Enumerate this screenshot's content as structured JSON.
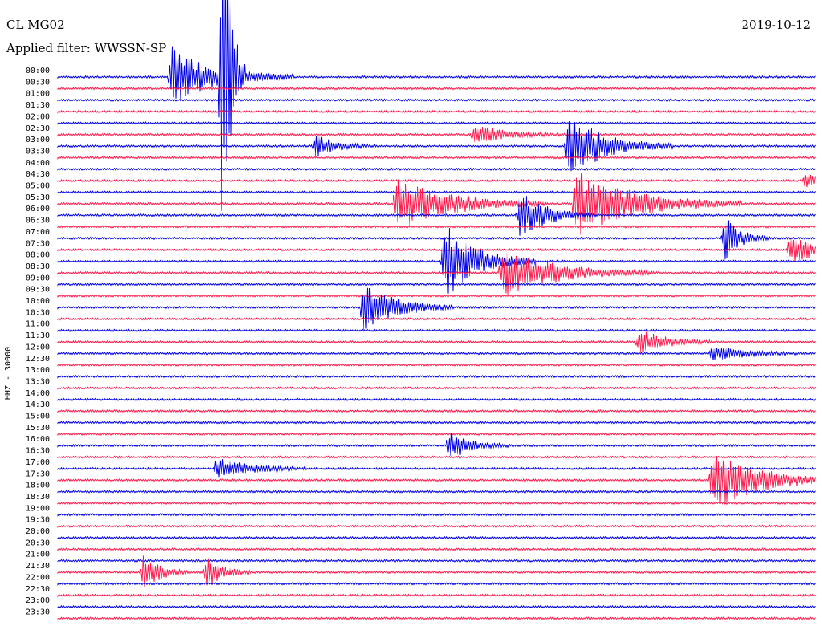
{
  "header": {
    "station": "CL MG02",
    "date": "2019-10-12",
    "filter": "Applied filter: WWSSN-SP"
  },
  "chart_data": {
    "type": "helicorder",
    "ylabel": "HHZ - 30000",
    "colors": [
      "#0000e6",
      "#ff1a4d"
    ],
    "traces": [
      {
        "label": "00:00",
        "color": "blue"
      },
      {
        "label": "00:30",
        "color": "red"
      },
      {
        "label": "01:00",
        "color": "blue"
      },
      {
        "label": "01:30",
        "color": "red"
      },
      {
        "label": "02:00",
        "color": "blue"
      },
      {
        "label": "02:30",
        "color": "red"
      },
      {
        "label": "03:00",
        "color": "blue"
      },
      {
        "label": "03:30",
        "color": "red"
      },
      {
        "label": "04:00",
        "color": "blue"
      },
      {
        "label": "04:30",
        "color": "red"
      },
      {
        "label": "05:00",
        "color": "blue"
      },
      {
        "label": "05:30",
        "color": "red"
      },
      {
        "label": "06:00",
        "color": "blue"
      },
      {
        "label": "06:30",
        "color": "red"
      },
      {
        "label": "07:00",
        "color": "blue"
      },
      {
        "label": "07:30",
        "color": "red"
      },
      {
        "label": "08:00",
        "color": "blue"
      },
      {
        "label": "08:30",
        "color": "red"
      },
      {
        "label": "09:00",
        "color": "blue"
      },
      {
        "label": "09:30",
        "color": "red"
      },
      {
        "label": "10:00",
        "color": "blue"
      },
      {
        "label": "10:30",
        "color": "red"
      },
      {
        "label": "11:00",
        "color": "blue"
      },
      {
        "label": "11:30",
        "color": "red"
      },
      {
        "label": "12:00",
        "color": "blue"
      },
      {
        "label": "12:30",
        "color": "red"
      },
      {
        "label": "13:00",
        "color": "blue"
      },
      {
        "label": "13:30",
        "color": "red"
      },
      {
        "label": "14:00",
        "color": "blue"
      },
      {
        "label": "14:30",
        "color": "red"
      },
      {
        "label": "15:00",
        "color": "blue"
      },
      {
        "label": "15:30",
        "color": "red"
      },
      {
        "label": "16:00",
        "color": "blue"
      },
      {
        "label": "16:30",
        "color": "red"
      },
      {
        "label": "17:00",
        "color": "blue"
      },
      {
        "label": "17:30",
        "color": "red"
      },
      {
        "label": "18:00",
        "color": "blue"
      },
      {
        "label": "18:30",
        "color": "red"
      },
      {
        "label": "19:00",
        "color": "blue"
      },
      {
        "label": "19:30",
        "color": "red"
      },
      {
        "label": "20:00",
        "color": "blue"
      },
      {
        "label": "20:30",
        "color": "red"
      },
      {
        "label": "21:00",
        "color": "blue"
      },
      {
        "label": "21:30",
        "color": "red"
      },
      {
        "label": "22:00",
        "color": "blue"
      },
      {
        "label": "22:30",
        "color": "red"
      },
      {
        "label": "23:00",
        "color": "blue"
      },
      {
        "label": "23:30",
        "color": "red"
      }
    ],
    "events": [
      {
        "trace": 0,
        "minute": 4.5,
        "amp": 38,
        "dur": 1.6
      },
      {
        "trace": 0,
        "minute": 6.5,
        "amp": 260,
        "dur": 0.3
      },
      {
        "trace": 5,
        "minute": 16.5,
        "amp": 12,
        "dur": 1.2
      },
      {
        "trace": 6,
        "minute": 10.2,
        "amp": 14,
        "dur": 0.8
      },
      {
        "trace": 6,
        "minute": 20.2,
        "amp": 40,
        "dur": 1.4
      },
      {
        "trace": 9,
        "minute": 29.6,
        "amp": 8,
        "dur": 1.0
      },
      {
        "trace": 11,
        "minute": 13.4,
        "amp": 34,
        "dur": 2.0
      },
      {
        "trace": 11,
        "minute": 20.5,
        "amp": 42,
        "dur": 2.2
      },
      {
        "trace": 12,
        "minute": 18.3,
        "amp": 30,
        "dur": 1.0
      },
      {
        "trace": 14,
        "minute": 26.4,
        "amp": 28,
        "dur": 0.6
      },
      {
        "trace": 14,
        "minute": 43.2,
        "amp": 260,
        "dur": 2.4
      },
      {
        "trace": 15,
        "minute": 29.0,
        "amp": 18,
        "dur": 1.0
      },
      {
        "trace": 16,
        "minute": 15.3,
        "amp": 48,
        "dur": 1.2
      },
      {
        "trace": 17,
        "minute": 17.6,
        "amp": 30,
        "dur": 2.0
      },
      {
        "trace": 17,
        "minute": 51.2,
        "amp": 58,
        "dur": 1.4
      },
      {
        "trace": 20,
        "minute": 12.1,
        "amp": 32,
        "dur": 1.2
      },
      {
        "trace": 20,
        "minute": 53.4,
        "amp": 42,
        "dur": 2.4
      },
      {
        "trace": 23,
        "minute": 23.0,
        "amp": 16,
        "dur": 1.0
      },
      {
        "trace": 24,
        "minute": 25.9,
        "amp": 10,
        "dur": 1.2
      },
      {
        "trace": 29,
        "minute": 39.4,
        "amp": 16,
        "dur": 1.6
      },
      {
        "trace": 32,
        "minute": 15.5,
        "amp": 18,
        "dur": 0.8
      },
      {
        "trace": 34,
        "minute": 6.3,
        "amp": 14,
        "dur": 1.2
      },
      {
        "trace": 35,
        "minute": 25.9,
        "amp": 38,
        "dur": 1.8
      },
      {
        "trace": 40,
        "minute": 39.9,
        "amp": 32,
        "dur": 1.4
      },
      {
        "trace": 41,
        "minute": 55.5,
        "amp": 60,
        "dur": 1.2
      },
      {
        "trace": 43,
        "minute": 3.4,
        "amp": 24,
        "dur": 0.6
      },
      {
        "trace": 43,
        "minute": 5.9,
        "amp": 20,
        "dur": 0.6
      },
      {
        "trace": 46,
        "minute": 44.6,
        "amp": 10,
        "dur": 1.0
      }
    ]
  }
}
